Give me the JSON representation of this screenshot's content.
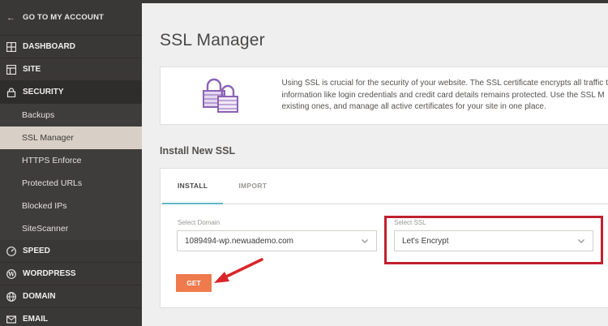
{
  "sidebar": {
    "back_label": "GO TO MY ACCOUNT",
    "items": [
      {
        "label": "DASHBOARD",
        "icon": "dashboard-icon"
      },
      {
        "label": "SITE",
        "icon": "site-icon"
      },
      {
        "label": "SECURITY",
        "icon": "lock-icon"
      },
      {
        "label": "SPEED",
        "icon": "speed-icon"
      },
      {
        "label": "WORDPRESS",
        "icon": "wordpress-icon"
      },
      {
        "label": "DOMAIN",
        "icon": "globe-icon"
      },
      {
        "label": "EMAIL",
        "icon": "email-icon"
      }
    ],
    "security_sub": [
      "Backups",
      "SSL Manager",
      "HTTPS Enforce",
      "Protected URLs",
      "Blocked IPs",
      "SiteScanner"
    ],
    "selected_sub": "SSL Manager"
  },
  "page": {
    "title": "SSL Manager",
    "info_lines": [
      "Using SSL is crucial for the security of your website. The SSL certificate encrypts all traffic t",
      "information like login credentials and credit card details remains protected. Use the SSL M",
      "existing ones, and manage all active certificates for your site in one place."
    ]
  },
  "install": {
    "section_title": "Install New SSL",
    "tabs": [
      "INSTALL",
      "IMPORT"
    ],
    "active_tab": "INSTALL",
    "domain_label": "Select Domain",
    "domain_value": "1089494-wp.newuademo.com",
    "ssl_label": "Select SSL",
    "ssl_value": "Let's Encrypt",
    "get_label": "GET"
  },
  "colors": {
    "sidebar_bg": "#3a3837",
    "selected_bg": "#d8d0c6",
    "accent_tab": "#5fb9c6",
    "get_button": "#ee7a4e",
    "highlight": "#c0202e",
    "lock_purple": "#8a63b5"
  }
}
